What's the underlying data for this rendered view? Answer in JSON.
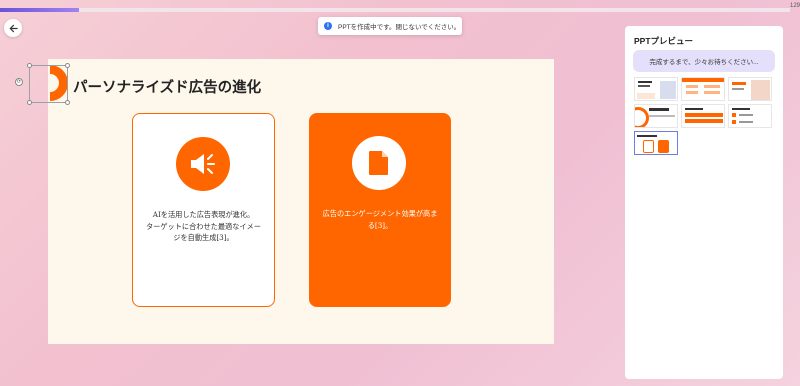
{
  "progress": {
    "fraction": 0.1,
    "text": "129"
  },
  "toast": {
    "text": "PPTを作成中です。閉じないでください。"
  },
  "slide": {
    "title": "パーソナライズド広告の進化",
    "card1": {
      "icon": "megaphone-icon",
      "text_line1": "AIを活用した広告表現が進化。",
      "text_line2": "ターゲットに合わせた最適なイメー",
      "text_line3": "ジを自動生成[3]。"
    },
    "card2": {
      "icon": "document-icon",
      "text_line1": "広告のエンゲージメント効果が高ま",
      "text_line2": "る[3]。"
    }
  },
  "panel": {
    "title": "PPTプレビュー",
    "wait_text": "完成するまで、少々お待ちください..."
  },
  "colors": {
    "accent": "#ff6600",
    "progress": "#7a5ce0",
    "info": "#2b73f0"
  }
}
